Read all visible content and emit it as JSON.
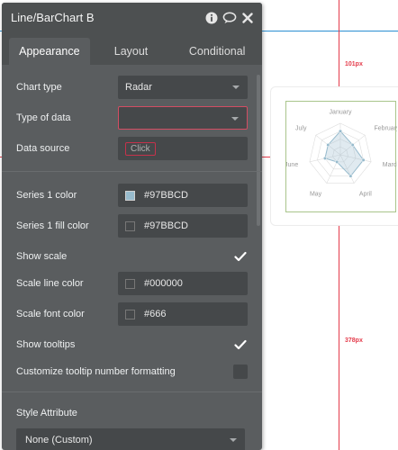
{
  "canvas": {
    "guide_label_top": "101px",
    "guide_label_bottom": "378px",
    "guide_blue": "#2a8ed1",
    "guide_red": "#e43b4b"
  },
  "chart_data": {
    "type": "radar",
    "categories": [
      "January",
      "February",
      "March",
      "April",
      "May",
      "June",
      "July"
    ],
    "values": [
      3,
      2,
      3,
      3,
      1,
      2,
      2
    ],
    "rmax": 4,
    "series_color": "#97BBCD",
    "grid_color": "#dddddd",
    "label_color": "#999999"
  },
  "panel": {
    "title": "Line/BarChart B",
    "tabs": [
      {
        "label": "Appearance",
        "active": true
      },
      {
        "label": "Layout",
        "active": false
      },
      {
        "label": "Conditional",
        "active": false
      }
    ],
    "fields": {
      "chart_type": {
        "label": "Chart type",
        "value": "Radar"
      },
      "type_of_data": {
        "label": "Type of data",
        "value": ""
      },
      "data_source": {
        "label": "Data source",
        "value": "Click"
      },
      "series1_color": {
        "label": "Series 1 color",
        "value": "#97BBCD",
        "swatch": "#97BBCD"
      },
      "series1_fill": {
        "label": "Series 1 fill color",
        "value": "#97BBCD",
        "swatch": "#45484a"
      },
      "show_scale": {
        "label": "Show scale",
        "checked": true
      },
      "scale_line_color": {
        "label": "Scale line color",
        "value": "#000000",
        "swatch": "#45484a"
      },
      "scale_font_color": {
        "label": "Scale font color",
        "value": "#666",
        "swatch": "#45484a"
      },
      "show_tooltips": {
        "label": "Show tooltips",
        "checked": true
      },
      "customize_tooltip": {
        "label": "Customize tooltip number formatting",
        "checked": false
      },
      "style_attribute": {
        "label": "Style Attribute",
        "value": "None (Custom)"
      }
    },
    "icons": [
      "info-icon",
      "comment-icon",
      "close-icon"
    ]
  }
}
